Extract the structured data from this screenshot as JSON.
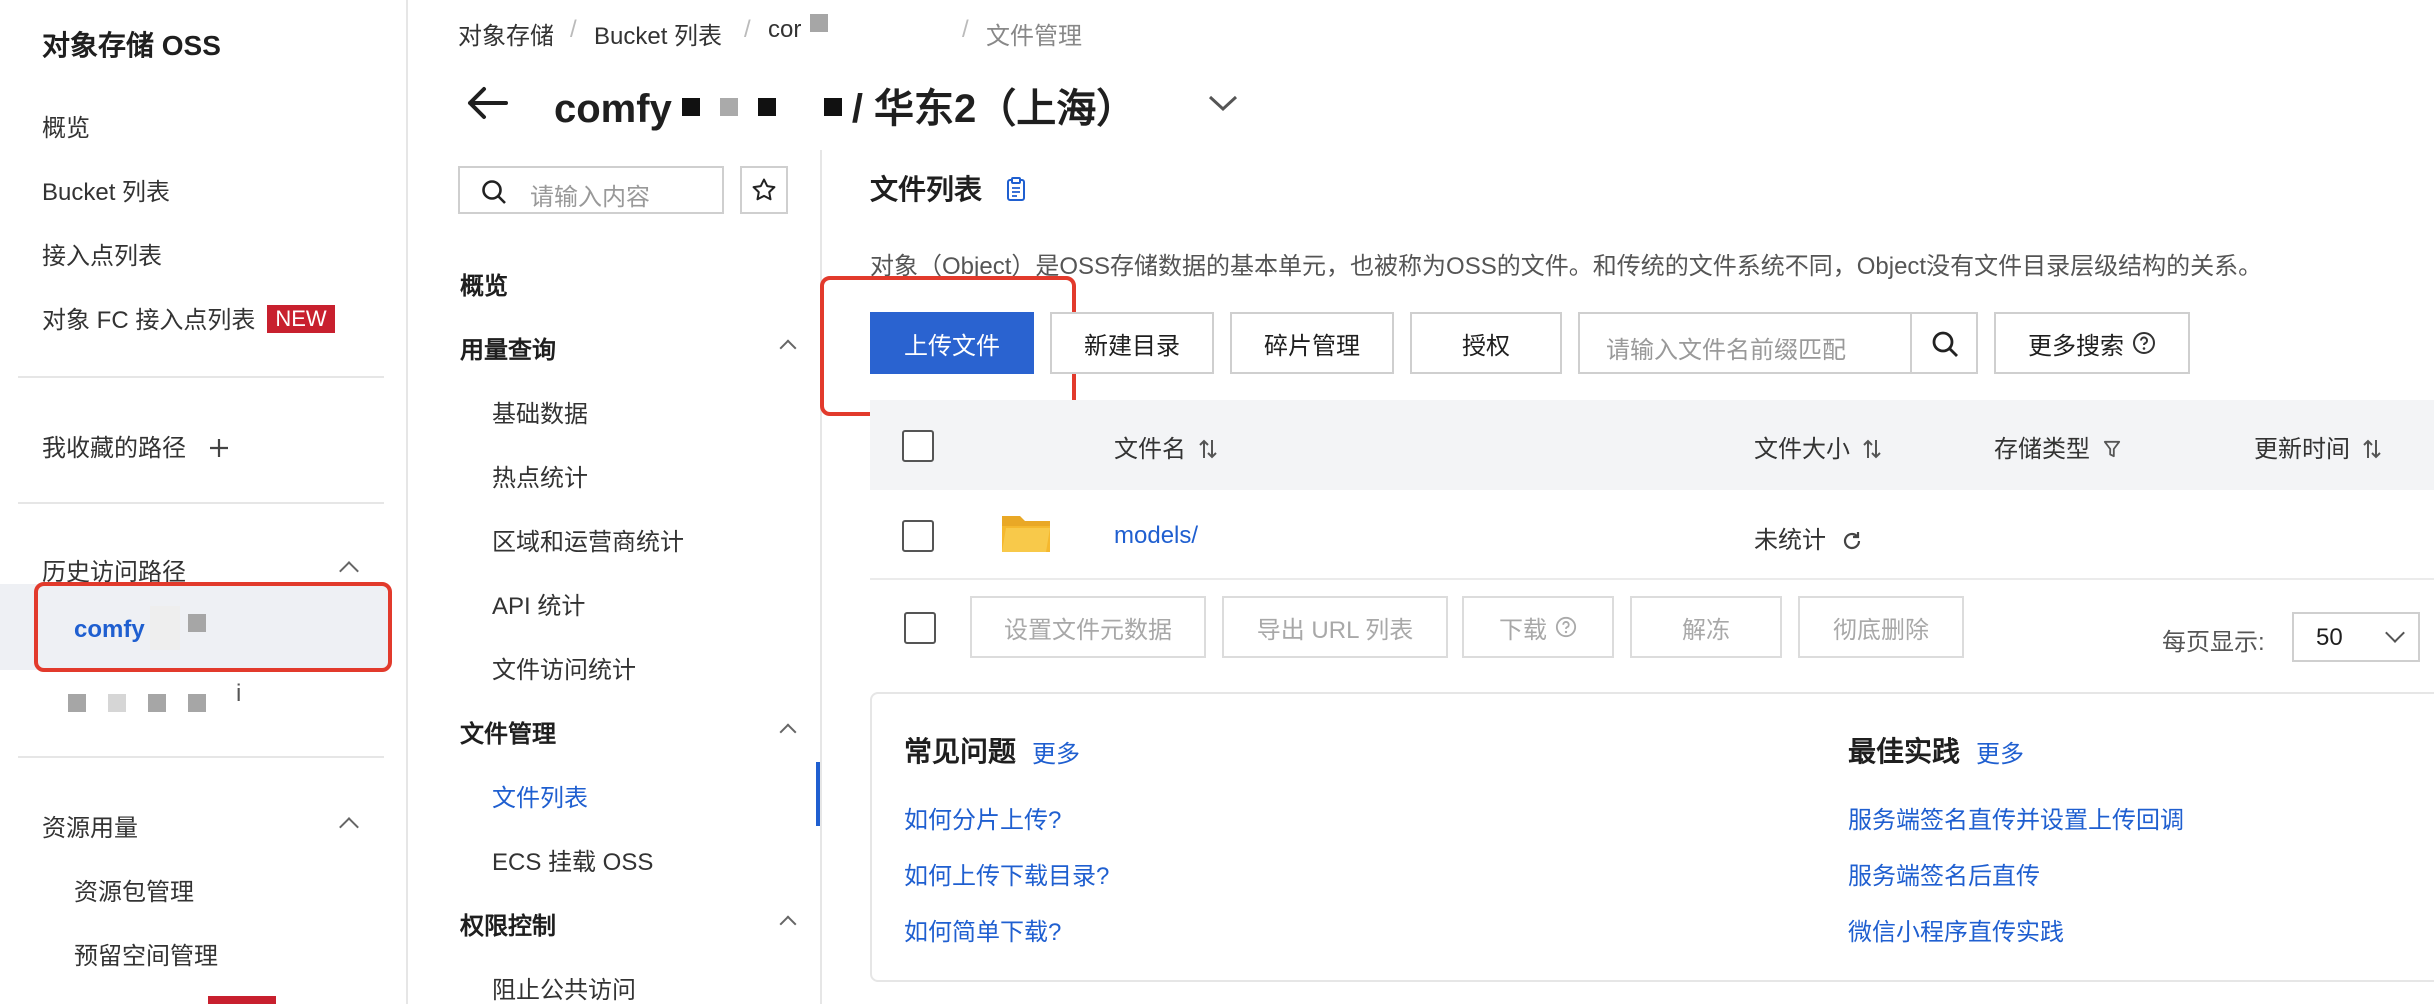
{
  "sidebar": {
    "title": "对象存储 OSS",
    "items": [
      {
        "label": "概览"
      },
      {
        "label": "Bucket 列表"
      },
      {
        "label": "接入点列表"
      },
      {
        "label": "对象 FC 接入点列表",
        "badge": "NEW"
      }
    ],
    "favorites_label": "我收藏的路径",
    "favorites_add_icon": "plus-icon",
    "history_label": "历史访问路径",
    "history_items": [
      {
        "label": "comfy"
      },
      {
        "label": "i"
      }
    ],
    "resource_label": "资源用量",
    "resource_items": [
      {
        "label": "资源包管理"
      },
      {
        "label": "预留空间管理"
      }
    ]
  },
  "breadcrumb": [
    "对象存储",
    "Bucket 列表",
    "cor",
    "文件管理"
  ],
  "header": {
    "bucket_name": "comfy",
    "region": "/ 华东2（上海）"
  },
  "nav2": {
    "search_placeholder": "请输入内容",
    "overview": "概览",
    "groups": [
      {
        "label": "用量查询",
        "items": [
          "基础数据",
          "热点统计",
          "区域和运营商统计",
          "API 统计",
          "文件访问统计"
        ]
      },
      {
        "label": "文件管理",
        "items": [
          "文件列表",
          "ECS 挂载 OSS"
        ],
        "active": "文件列表"
      },
      {
        "label": "权限控制",
        "items": [
          "阻止公共访问"
        ]
      }
    ]
  },
  "main": {
    "title": "文件列表",
    "description": "对象（Object）是OSS存储数据的基本单元，也被称为OSS的文件。和传统的文件系统不同，Object没有文件目录层级结构的关系。",
    "toolbar": {
      "upload": "上传文件",
      "new_dir": "新建目录",
      "fragments": "碎片管理",
      "authorize": "授权",
      "search_placeholder": "请输入文件名前缀匹配",
      "more_search": "更多搜索"
    },
    "columns": {
      "name": "文件名",
      "size": "文件大小",
      "storage_type": "存储类型",
      "updated": "更新时间"
    },
    "rows": [
      {
        "name": "models/",
        "size": "未统计",
        "type": "folder"
      }
    ],
    "bulk_actions": {
      "set_meta": "设置文件元数据",
      "export_url": "导出 URL 列表",
      "download": "下载",
      "unfreeze": "解冻",
      "delete": "彻底删除"
    },
    "per_page_label": "每页显示:",
    "per_page_value": "50"
  },
  "faq": {
    "title": "常见问题",
    "more": "更多",
    "links": [
      "如何分片上传?",
      "如何上传下载目录?",
      "如何简单下载?"
    ]
  },
  "best_practice": {
    "title": "最佳实践",
    "more": "更多",
    "links": [
      "服务端签名直传并设置上传回调",
      "服务端签名后直传",
      "微信小程序直传实践"
    ]
  },
  "colors": {
    "accent": "#2a63d0",
    "link": "#1f5fd0",
    "highlight": "#e23a2c",
    "badge": "#c8202e",
    "folder": "#f5b82e"
  }
}
